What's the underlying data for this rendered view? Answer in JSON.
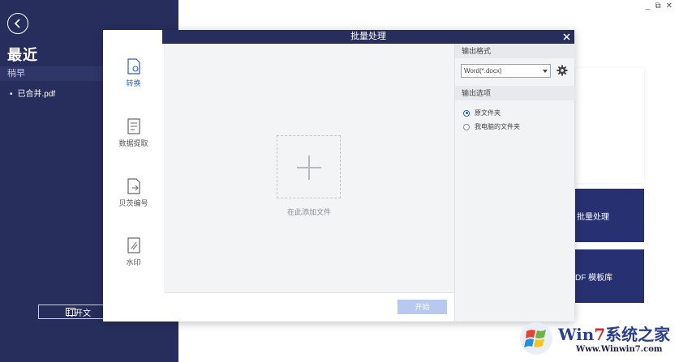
{
  "sidebar": {
    "recent_title": "最近",
    "section_label": "稍早",
    "files": [
      "已合并.pdf"
    ],
    "open_file_label": "打开文"
  },
  "background_tiles": {
    "batch_label": "批量处理",
    "template_label": "DF 模板库"
  },
  "window_controls": [
    "_",
    "⧉",
    "✕"
  ],
  "dialog": {
    "title": "批量处理",
    "nav": [
      {
        "label": "转换",
        "icon": "convert-icon",
        "active": true
      },
      {
        "label": "数据提取",
        "icon": "data-extract-icon",
        "active": false
      },
      {
        "label": "贝茨编号",
        "icon": "bates-number-icon",
        "active": false
      },
      {
        "label": "水印",
        "icon": "watermark-icon",
        "active": false
      }
    ],
    "drop_label": "在此添加文件",
    "start_label": "开始",
    "output_format_title": "输出格式",
    "output_format_value": "Word(*.docx)",
    "output_options_title": "输出选项",
    "options": [
      {
        "label": "原文件夹",
        "selected": true
      },
      {
        "label": "我电脑的文件夹",
        "selected": false
      }
    ]
  },
  "watermark": {
    "brand_prefix": "Win",
    "brand_seven": "7",
    "brand_suffix": "系统之家",
    "url": "Www.Winwin7.com"
  },
  "colors": {
    "sidebar_bg": "#272e5c",
    "accent_blue": "#2b5fc0",
    "start_disabled": "#b9c8ee"
  }
}
